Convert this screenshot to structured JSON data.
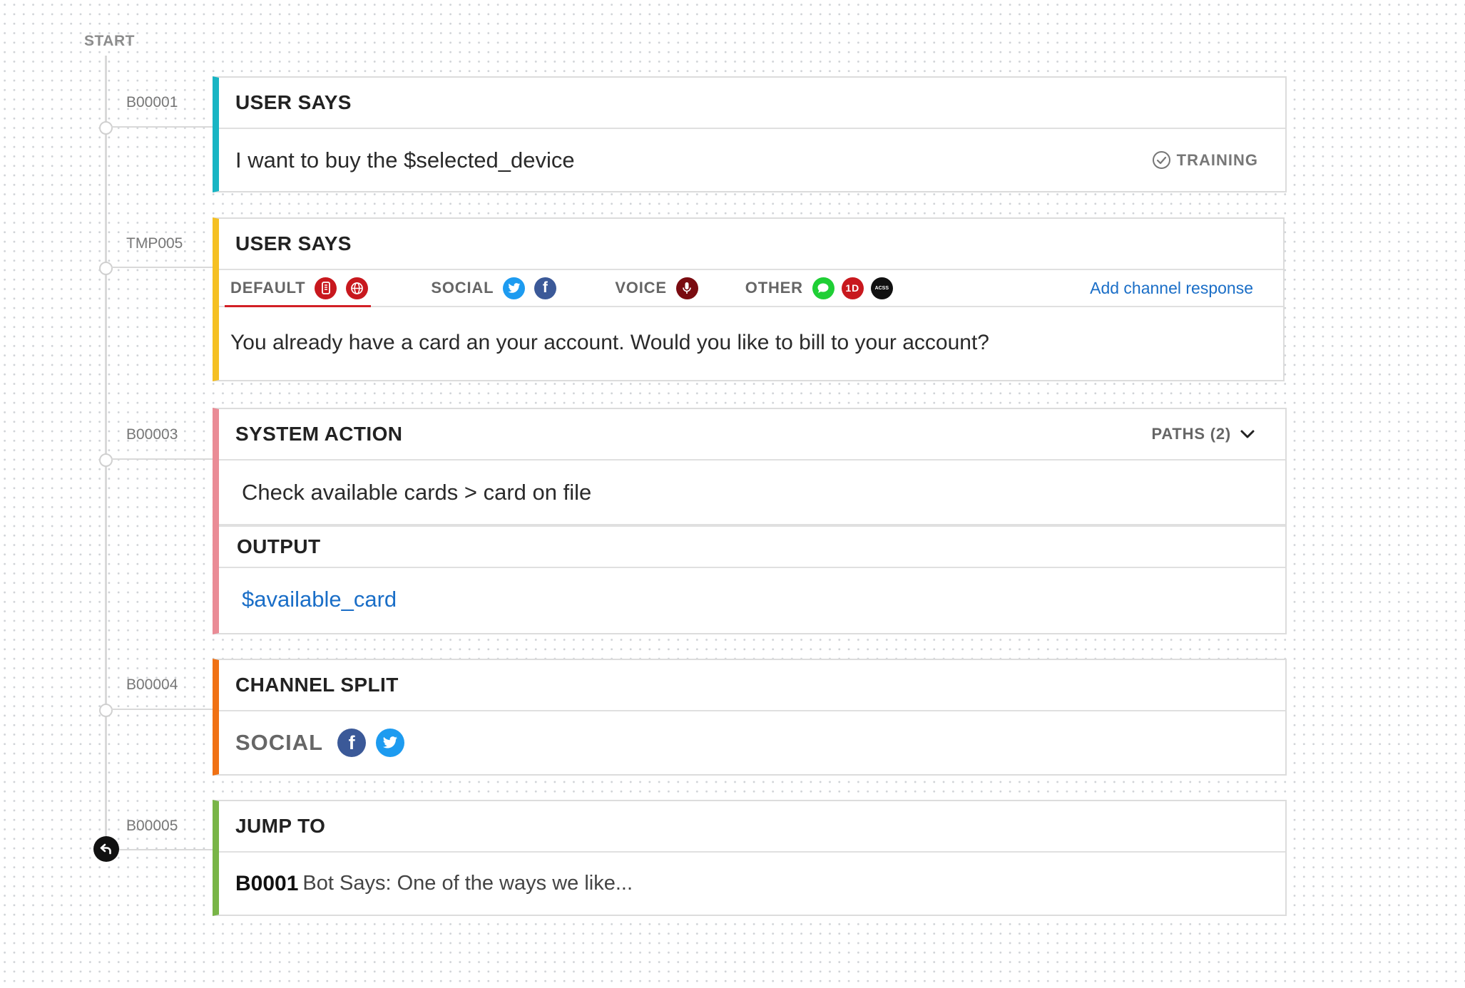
{
  "timeline": {
    "start_label": "START",
    "ids": [
      "B00001",
      "TMP005",
      "B00003",
      "B00004",
      "B00005"
    ]
  },
  "colors": {
    "user_says_1": "#18b5c4",
    "user_says_2": "#f5c023",
    "system_action": "#ea8c96",
    "channel_split": "#f07114",
    "jump_to": "#79b547",
    "link_blue": "#1a6ec7",
    "active_tab_underline": "#d21f26"
  },
  "blocks": [
    {
      "title": "USER SAYS",
      "text": "I want to buy the $selected_device",
      "status_icon": "check-circle-icon",
      "status": "TRAINING"
    },
    {
      "title": "USER SAYS",
      "tabs": [
        {
          "label": "DEFAULT",
          "icons": [
            "mobile-icon",
            "globe-icon"
          ]
        },
        {
          "label": "SOCIAL",
          "icons": [
            "twitter-icon",
            "facebook-icon"
          ]
        },
        {
          "label": "VOICE",
          "icons": [
            "microphone-icon"
          ]
        },
        {
          "label": "OTHER",
          "icons": [
            "messages-icon",
            "1d-icon",
            "acss-icon"
          ]
        }
      ],
      "other_icon_text": {
        "id": "1D",
        "acss": "ACSS"
      },
      "add_channel_label": "Add channel response",
      "text": "You already have a card an your account. Would you like to bill to your account?"
    },
    {
      "title": "SYSTEM ACTION",
      "paths_label": "PATHS (2)",
      "action_text": "Check available cards > card on file",
      "output_title": "OUTPUT",
      "output_value": "$available_card"
    },
    {
      "title": "CHANNEL SPLIT",
      "channel_label": "SOCIAL",
      "icons": [
        "facebook-icon",
        "twitter-icon"
      ]
    },
    {
      "title": "JUMP TO",
      "target_id": "B0001",
      "target_text": "Bot Says: One of the ways we like..."
    }
  ]
}
